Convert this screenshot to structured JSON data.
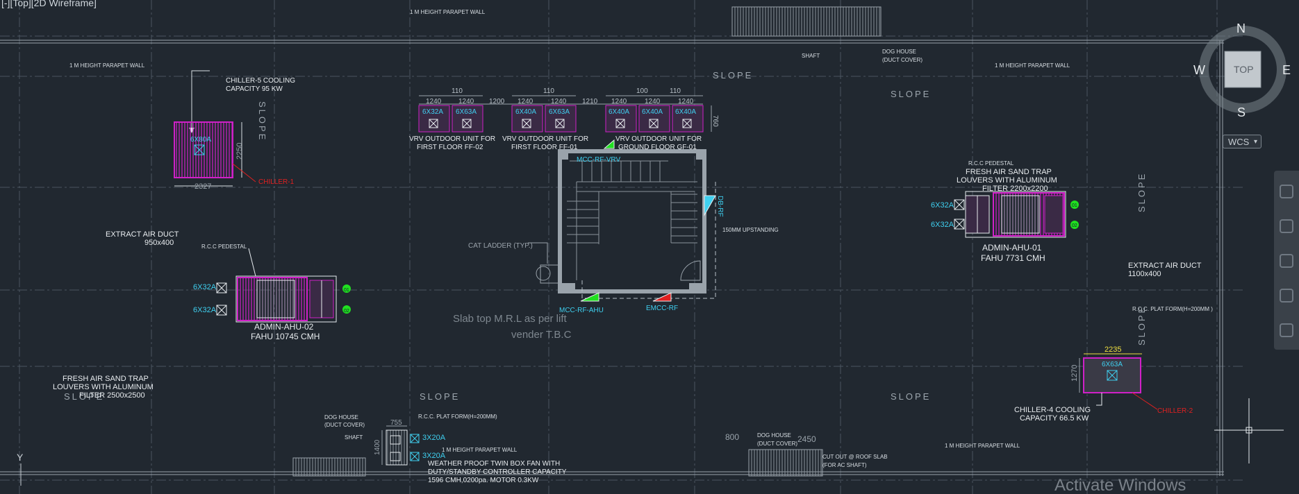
{
  "viewport": {
    "label": "[-][Top][2D Wireframe]",
    "watermark": "Activate Windows"
  },
  "viewcube": {
    "north": "N",
    "south": "S",
    "east": "E",
    "west": "W",
    "face": "TOP",
    "ucs": "WCS"
  },
  "ucs_icon": {
    "axis": "Y"
  },
  "colors": {
    "background": "#212830",
    "grid": "#4a5560",
    "text": "#e8ecef",
    "cyan": "#3fd0f0",
    "magenta": "#d020c8",
    "red": "#e02020",
    "green": "#20e020",
    "yellow": "#f0e040"
  },
  "labels": {
    "parapet_top": "1 M HEIGHT PARAPET WALL",
    "parapet_left": "1 M HEIGHT PARAPET WALL",
    "parapet_right": "1 M HEIGHT PARAPET WALL",
    "parapet_bottom_mid": "1 M HEIGHT PARAPET WALL",
    "parapet_bottom_right": "1 M HEIGHT PARAPET WALL",
    "shaft_top": "SHAFT",
    "doghouse_top_1": "DOG HOUSE",
    "doghouse_top_2": "(DUCT COVER)",
    "slope_1": "SLOPE",
    "slope_2": "SLOPE",
    "slope_3": "SLOPE",
    "slope_4": "SLOPE",
    "slope_5": "SLOPE",
    "slope_v1": "SLOPE",
    "slope_v2": "SLOPE",
    "slope_v3": "SLOPE",
    "chiller5_1": "CHILLER-5 COOLING",
    "chiller5_2": "CAPACITY 95 KW",
    "chiller5_breaker": "6X80A",
    "chiller5_dim_w": "2327",
    "chiller5_dim_h": "2250",
    "chiller5_tag": "CHILLER-1",
    "vrv_dims_top_1": "110",
    "vrv_dims_top_2": "110",
    "vrv_dims_top_3": "100",
    "vrv_dims_top_4": "110",
    "vrv_dim_a": "1240",
    "vrv_dim_b": "1240",
    "vrv_dim_c": "1200",
    "vrv_dim_d": "1240",
    "vrv_dim_e": "1240",
    "vrv_dim_f": "1210",
    "vrv_dim_g": "1240",
    "vrv_dim_h": "1240",
    "vrv_dim_i": "1240",
    "vrv_dim_side": "760",
    "vrv_b1": "6X32A",
    "vrv_b2": "6X63A",
    "vrv_b3": "6X40A",
    "vrv_b4": "6X63A",
    "vrv_b5": "6X40A",
    "vrv_b6": "6X40A",
    "vrv_b7": "6X40A",
    "vrv1_1": "VRV OUTDOOR UNIT FOR",
    "vrv1_2": "FIRST FLOOR FF-02",
    "vrv2_1": "VRV OUTDOOR UNIT FOR",
    "vrv2_2": "FIRST FLOOR FF-01",
    "vrv3_1": "VRV OUTDOOR UNIT FOR",
    "vrv3_2": "GROUND FLOOR GF-01",
    "mcc_rf_vrv": "MCC-RF-VRV",
    "mcc_rf_ahu": "MCC-RF-AHU",
    "emcc_rf": "EMCC-RF",
    "db_rf": "DB-RF",
    "upstanding": "150MM UPSTANDING",
    "cat_ladder": "CAT LADDER (TYP.)",
    "slab_1": "Slab top M.R.L as per lift",
    "slab_2": "vender T.B.C",
    "extract_left_1": "EXTRACT AIR DUCT",
    "extract_left_2": "950x400",
    "rcc_pedestal_left": "R.C.C PEDESTAL",
    "ahu02_b1": "6X32A",
    "ahu02_b2": "6X32A",
    "ahu02_1": "ADMIN-AHU-02",
    "ahu02_2": "FAHU 10745 CMH",
    "ahu02_g1": "01",
    "ahu02_g2": "02",
    "fresh_left_1": "FRESH AIR SAND TRAP",
    "fresh_left_2": "LOUVERS WITH ALUMINUM",
    "fresh_left_3": "FILTER 2500x2500",
    "rcc_pedestal_right": "R.C.C PEDESTAL",
    "fresh_right_1": "FRESH AIR SAND TRAP",
    "fresh_right_2": "LOUVERS WITH ALUMINUM",
    "fresh_right_3": "FILTER 2200x2200",
    "ahu01_b1": "6X32A",
    "ahu01_b2": "6X32A",
    "ahu01_1": "ADMIN-AHU-01",
    "ahu01_2": "FAHU 7731 CMH",
    "ahu01_g1": "01",
    "ahu01_g2": "02",
    "extract_right_1": "EXTRACT AIR DUCT",
    "extract_right_2": "1100x400",
    "rcc_plat_right": "R.C.C. PLAT FORM(H=200MM )",
    "chiller4_dim_w": "2235",
    "chiller4_dim_h": "1270",
    "chiller4_breaker": "6X63A",
    "chiller4_1": "CHILLER-4 COOLING",
    "chiller4_2": "CAPACITY 66.5 KW",
    "chiller4_tag": "CHILLER-2",
    "doghouse_bl_1": "DOG HOUSE",
    "doghouse_bl_2": "(DUCT COVER)",
    "shaft_bl": "SHAFT",
    "fan_dim_w": "755",
    "fan_dim_h": "1400",
    "fan_b1": "3X20A",
    "fan_b2": "3X20A",
    "rcc_plat_mid": "R.C.C. PLAT FORM(H=200MM)",
    "fan_1": "WEATHER PROOF TWIN BOX FAN WITH",
    "fan_2": "DUTY/STANDBY CONTROLLER CAPACITY",
    "fan_3": "1596 CMH,0200pa. MOTOR 0.3KW",
    "doghouse_bm_1": "DOG HOUSE",
    "doghouse_bm_2": "(DUCT COVER)",
    "dim_800": "800",
    "dim_2450": "2450",
    "cutout_1": "CUT OUT @ ROOF SLAB",
    "cutout_2": "(FOR AC SHAFT)"
  }
}
